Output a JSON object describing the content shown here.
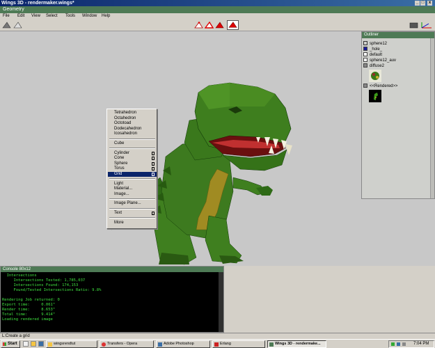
{
  "window": {
    "title": "Wings 3D - rendermaker.wings*",
    "controls": [
      "_",
      "□",
      "x"
    ]
  },
  "geometry_title": "Geometry",
  "menubar": [
    "File",
    "Edit",
    "View",
    "Select",
    "Tools",
    "Window",
    "Help"
  ],
  "outliner": {
    "title": "Outliner",
    "items": [
      {
        "label": "sphere12",
        "icon": "object-icon"
      },
      {
        "label": "_hole_",
        "icon": "material-icon"
      },
      {
        "label": "default",
        "icon": "material-icon"
      },
      {
        "label": "sphere12_auv",
        "icon": "material-icon"
      },
      {
        "label": "diffuse2",
        "icon": "image-icon"
      },
      {
        "label": "<<Rendered>>",
        "icon": "image-icon"
      }
    ]
  },
  "context_menu": {
    "groups": [
      [
        "Tetrahedron",
        "Octahedron",
        "Octotoad",
        "Dodecahedron",
        "Icosahedron"
      ],
      [
        "Cube"
      ],
      [
        "Cylinder",
        "Cone",
        "Sphere",
        "Torus",
        "Grid"
      ],
      [
        "Light",
        "Material...",
        "Image..."
      ],
      [
        "Image Plane..."
      ],
      [
        "Text"
      ],
      [
        "More"
      ]
    ],
    "selected": "Grid",
    "with_options": [
      "Cylinder",
      "Cone",
      "Sphere",
      "Torus",
      "Grid",
      "Text"
    ]
  },
  "console": {
    "title": "Console 80x12",
    "lines": [
      "  Intersections",
      "     Intersections Tested: 1,785,037",
      "     Intersections Found: 174,153",
      "     Found/Tested Intersections Ratio: 9.8%",
      "",
      "Rendering Job returned: 0",
      "Export time:     0.061\"",
      "Render time:     8.653\"",
      "Total time:      9.414\"",
      "Loading rendered image"
    ]
  },
  "status": "L:Create a grid",
  "taskbar": {
    "start_label": "Start",
    "tasks": [
      {
        "label": "wingsrendtut",
        "active": false
      },
      {
        "label": "Transfers - Opera",
        "active": false
      },
      {
        "label": "Adobe Photoshop",
        "active": false
      },
      {
        "label": "Erlang",
        "active": false
      },
      {
        "label": "Wings 3D - rendermake...",
        "active": true
      }
    ],
    "clock": "7:04 PM"
  },
  "colors": {
    "title_bar": "#0a246a",
    "panel_header": "#4e7a55",
    "console_text": "#3fe03f",
    "selection": "#0a246a",
    "model": "#3d7a1f"
  }
}
